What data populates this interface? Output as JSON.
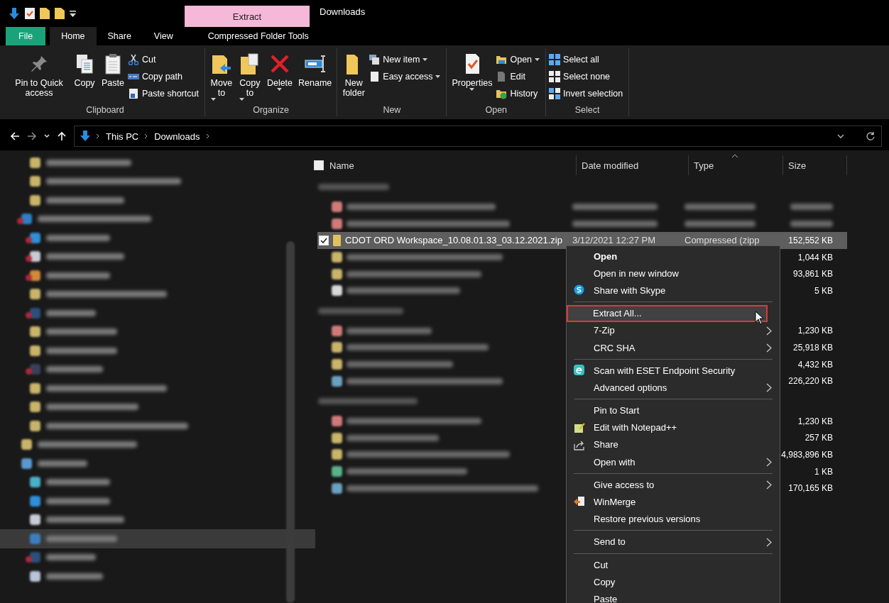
{
  "window": {
    "title": "Downloads"
  },
  "contextual_tab": {
    "label": "Extract",
    "group": "Compressed Folder Tools"
  },
  "ribbon_tabs": [
    {
      "label": "File",
      "kind": "file",
      "selected": false
    },
    {
      "label": "Home",
      "kind": "tab",
      "selected": true
    },
    {
      "label": "Share",
      "kind": "tab",
      "selected": false
    },
    {
      "label": "View",
      "kind": "tab",
      "selected": false
    }
  ],
  "ribbon_groups": [
    {
      "label": "Clipboard",
      "buttons": [
        {
          "label": "Pin to Quick access",
          "kind": "large",
          "dropdown": false
        },
        {
          "label": "Copy",
          "kind": "large",
          "dropdown": false
        },
        {
          "label": "Paste",
          "kind": "large",
          "dropdown": false
        },
        {
          "label": "Cut",
          "kind": "small",
          "dropdown": false
        },
        {
          "label": "Copy path",
          "kind": "small",
          "dropdown": false
        },
        {
          "label": "Paste shortcut",
          "kind": "small",
          "dropdown": false
        }
      ]
    },
    {
      "label": "Organize",
      "buttons": [
        {
          "label": "Move to",
          "kind": "large",
          "dropdown": true
        },
        {
          "label": "Copy to",
          "kind": "large",
          "dropdown": true
        },
        {
          "label": "Delete",
          "kind": "large",
          "dropdown": true
        },
        {
          "label": "Rename",
          "kind": "large",
          "dropdown": false
        }
      ]
    },
    {
      "label": "New",
      "buttons": [
        {
          "label": "New folder",
          "kind": "large",
          "dropdown": false
        },
        {
          "label": "New item",
          "kind": "small",
          "dropdown": true
        },
        {
          "label": "Easy access",
          "kind": "small",
          "dropdown": true
        }
      ]
    },
    {
      "label": "Open",
      "buttons": [
        {
          "label": "Properties",
          "kind": "large",
          "dropdown": true
        },
        {
          "label": "Open",
          "kind": "small",
          "dropdown": true
        },
        {
          "label": "Edit",
          "kind": "small",
          "dropdown": false
        },
        {
          "label": "History",
          "kind": "small",
          "dropdown": false
        }
      ]
    },
    {
      "label": "Select",
      "buttons": [
        {
          "label": "Select all",
          "kind": "small",
          "dropdown": false
        },
        {
          "label": "Select none",
          "kind": "small",
          "dropdown": false
        },
        {
          "label": "Invert selection",
          "kind": "small",
          "dropdown": false
        }
      ]
    }
  ],
  "address": {
    "path": [
      "This PC",
      "Downloads"
    ]
  },
  "sidebar": {
    "continued": [
      {
        "selected": false
      },
      {
        "selected": false
      },
      {
        "selected": false
      }
    ],
    "items": [
      {
        "selected": false,
        "children": [
          {
            "selected": false
          },
          {
            "selected": false
          },
          {
            "selected": false
          },
          {
            "selected": false
          },
          {
            "selected": false
          },
          {
            "selected": false
          },
          {
            "selected": false
          },
          {
            "selected": false
          },
          {
            "selected": false
          },
          {
            "selected": false
          },
          {
            "selected": false
          }
        ]
      },
      {
        "selected": false
      },
      {
        "selected": false,
        "children": [
          {
            "selected": false
          },
          {
            "selected": false
          },
          {
            "selected": false
          },
          {
            "selected": true
          },
          {
            "selected": false
          },
          {
            "selected": false
          }
        ]
      }
    ]
  },
  "columns": [
    {
      "label": "Name",
      "sorted": false
    },
    {
      "label": "Date modified",
      "sorted": false
    },
    {
      "label": "Type",
      "sorted": true
    },
    {
      "label": "Size",
      "sorted": false
    }
  ],
  "select_all": {
    "checked": false
  },
  "groups": [
    {
      "rows": [
        {
          "selected": false
        },
        {
          "selected": false
        },
        {
          "name": "CDOT ORD Workspace_10.08.01.33_03.12.2021.zip",
          "date": "3/12/2021 12:27 PM",
          "type": "Compressed (zipp",
          "size": "152,552 KB",
          "selected": true
        },
        {
          "size": "1,044 KB",
          "selected": false
        },
        {
          "size": "93,861 KB",
          "selected": false
        },
        {
          "size": "5 KB",
          "selected": false
        }
      ]
    },
    {
      "rows": [
        {
          "size": "1,230 KB",
          "selected": false
        },
        {
          "size": "25,918 KB",
          "selected": false
        },
        {
          "size": "4,432 KB",
          "selected": false
        },
        {
          "size": "226,220 KB",
          "selected": false
        }
      ]
    },
    {
      "rows": [
        {
          "size": "1,230 KB",
          "selected": false
        },
        {
          "size": "257 KB",
          "selected": false
        },
        {
          "size": "4,983,896 KB",
          "selected": false
        },
        {
          "size": "1 KB",
          "selected": false
        },
        {
          "size": "170,165 KB",
          "selected": false
        }
      ]
    }
  ],
  "context_menu": {
    "items": [
      {
        "kind": "item",
        "label": "Open",
        "bold": true,
        "submenu": false,
        "selected": false
      },
      {
        "kind": "item",
        "label": "Open in new window",
        "bold": false,
        "submenu": false,
        "selected": false
      },
      {
        "kind": "item",
        "label": "Share with Skype",
        "bold": false,
        "submenu": false,
        "selected": false
      },
      {
        "kind": "separator"
      },
      {
        "kind": "item",
        "label": "Extract All...",
        "bold": false,
        "submenu": false,
        "selected": true
      },
      {
        "kind": "item",
        "label": "7-Zip",
        "bold": false,
        "submenu": true,
        "selected": false
      },
      {
        "kind": "item",
        "label": "CRC SHA",
        "bold": false,
        "submenu": true,
        "selected": false
      },
      {
        "kind": "separator"
      },
      {
        "kind": "item",
        "label": "Scan with ESET Endpoint Security",
        "bold": false,
        "submenu": false,
        "selected": false
      },
      {
        "kind": "item",
        "label": "Advanced options",
        "bold": false,
        "submenu": true,
        "selected": false
      },
      {
        "kind": "separator"
      },
      {
        "kind": "item",
        "label": "Pin to Start",
        "bold": false,
        "submenu": false,
        "selected": false
      },
      {
        "kind": "item",
        "label": "Edit with Notepad++",
        "bold": false,
        "submenu": false,
        "selected": false
      },
      {
        "kind": "item",
        "label": "Share",
        "bold": false,
        "submenu": false,
        "selected": false
      },
      {
        "kind": "item",
        "label": "Open with",
        "bold": false,
        "submenu": true,
        "selected": false
      },
      {
        "kind": "separator"
      },
      {
        "kind": "item",
        "label": "Give access to",
        "bold": false,
        "submenu": true,
        "selected": false
      },
      {
        "kind": "item",
        "label": "WinMerge",
        "bold": false,
        "submenu": false,
        "selected": false
      },
      {
        "kind": "item",
        "label": "Restore previous versions",
        "bold": false,
        "submenu": false,
        "selected": false
      },
      {
        "kind": "separator"
      },
      {
        "kind": "item",
        "label": "Send to",
        "bold": false,
        "submenu": true,
        "selected": false
      },
      {
        "kind": "separator"
      },
      {
        "kind": "item",
        "label": "Cut",
        "bold": false,
        "submenu": false,
        "selected": false
      },
      {
        "kind": "item",
        "label": "Copy",
        "bold": false,
        "submenu": false,
        "selected": false
      },
      {
        "kind": "item",
        "label": "Paste",
        "bold": false,
        "submenu": false,
        "selected": false
      }
    ]
  }
}
